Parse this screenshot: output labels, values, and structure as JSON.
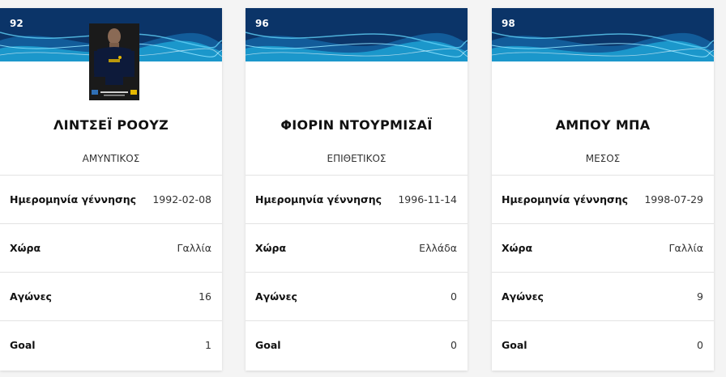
{
  "players": [
    {
      "number": "92",
      "name": "ΛΙΝΤΣΕΪ ΡΟΟΥΖ",
      "position": "ΑΜΥΝΤΙΚΟΣ",
      "has_photo": true,
      "stats": [
        {
          "label": "Ημερομηνία γέννησης",
          "value": "1992-02-08"
        },
        {
          "label": "Χώρα",
          "value": "Γαλλία"
        },
        {
          "label": "Αγώνες",
          "value": "16"
        },
        {
          "label": "Goal",
          "value": "1"
        }
      ]
    },
    {
      "number": "96",
      "name": "ΦΙΟΡΙΝ ΝΤΟΥΡΜΙΣΑΪ",
      "position": "ΕΠΙΘΕΤΙΚΟΣ",
      "has_photo": false,
      "stats": [
        {
          "label": "Ημερομηνία γέννησης",
          "value": "1996-11-14"
        },
        {
          "label": "Χώρα",
          "value": "Ελλάδα"
        },
        {
          "label": "Αγώνες",
          "value": "0"
        },
        {
          "label": "Goal",
          "value": "0"
        }
      ]
    },
    {
      "number": "98",
      "name": "ΑΜΠΟΥ ΜΠΑ",
      "position": "ΜΕΣΟΣ",
      "has_photo": false,
      "stats": [
        {
          "label": "Ημερομηνία γέννησης",
          "value": "1998-07-29"
        },
        {
          "label": "Χώρα",
          "value": "Γαλλία"
        },
        {
          "label": "Αγώνες",
          "value": "9"
        },
        {
          "label": "Goal",
          "value": "0"
        }
      ]
    }
  ],
  "colors": {
    "banner": "#0b3468",
    "wave_light": "#1fb0e0",
    "wave_mid": "#1a7ec2",
    "card": "#ffffff",
    "background": "#f4f4f4"
  }
}
